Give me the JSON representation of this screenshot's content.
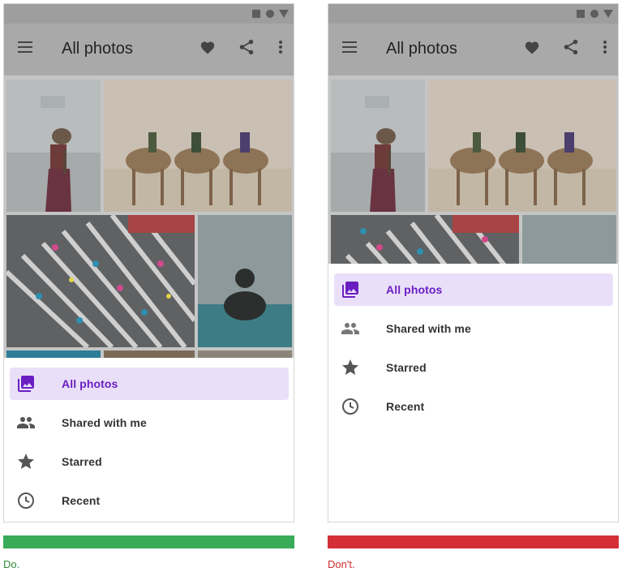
{
  "colors": {
    "do_bar": "#3aab58",
    "dont_bar": "#d42f36",
    "do_text": "#2e8b3a",
    "dont_text": "#cc2b2b",
    "active_bg": "#eadff8",
    "active_text": "#6a1fc2"
  },
  "do_example": {
    "app_title": "All photos",
    "menu": [
      {
        "label": "All photos",
        "icon": "photo-library-icon",
        "active": true
      },
      {
        "label": "Shared with me",
        "icon": "people-icon",
        "active": false
      },
      {
        "label": "Starred",
        "icon": "star-icon",
        "active": false
      },
      {
        "label": "Recent",
        "icon": "clock-icon",
        "active": false
      }
    ],
    "caption": "Do."
  },
  "dont_example": {
    "app_title": "All photos",
    "menu": [
      {
        "label": "All photos",
        "icon": "photo-library-icon",
        "active": true
      },
      {
        "label": "Shared with me",
        "icon": "people-icon",
        "active": false
      },
      {
        "label": "Starred",
        "icon": "star-icon",
        "active": false
      },
      {
        "label": "Recent",
        "icon": "clock-icon",
        "active": false
      }
    ],
    "caption": "Don't."
  }
}
